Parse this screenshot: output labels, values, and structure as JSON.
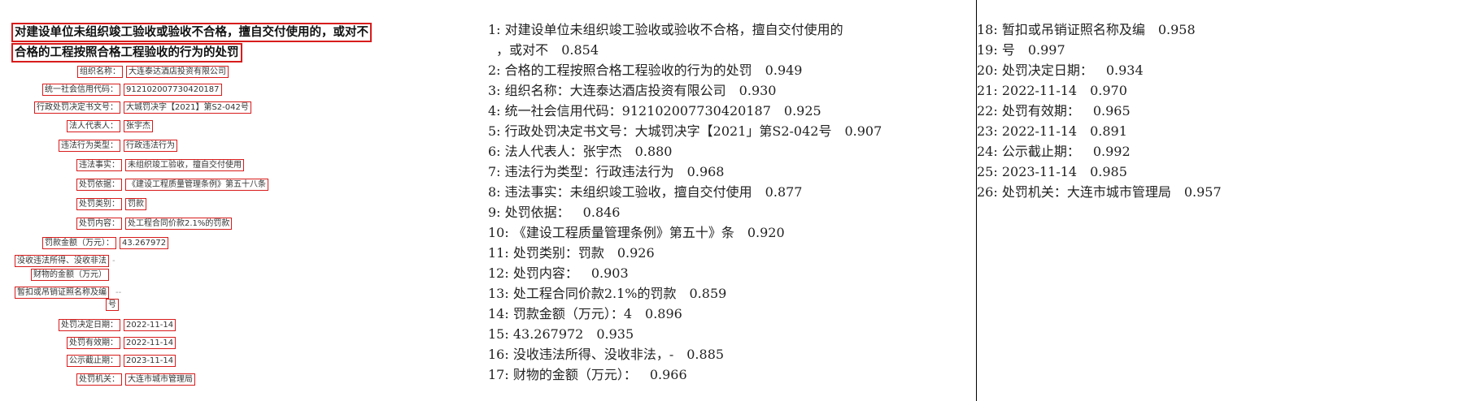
{
  "image_panel": {
    "title_lines": [
      "对建设单位未组织竣工验收或验收不合格，擅自交付使用的，或对不",
      "合格的工程按照合格工程验收的行为的处罚"
    ],
    "fields": [
      {
        "label": "组织名称：",
        "value": "大连泰达酒店投资有限公司"
      },
      {
        "label": "统一社会信用代码：",
        "value": "912102007730420187"
      },
      {
        "label": "行政处罚决定书文号：",
        "value": "大城罚决字【2021】第S2-042号"
      },
      {
        "label": "法人代表人：",
        "value": "张宇杰"
      },
      {
        "label": "违法行为类型：",
        "value": "行政违法行为"
      },
      {
        "label": "违法事实：",
        "value": "未组织竣工验收，擅自交付使用"
      },
      {
        "label": "处罚依据：",
        "value": "《建设工程质量管理条例》第五十八条"
      },
      {
        "label": "处罚类别：",
        "value": "罚款"
      },
      {
        "label": "处罚内容：",
        "value": "处工程合同价款2.1%的罚款"
      },
      {
        "label": "罚款金额（万元）：",
        "value": "43.267972"
      },
      {
        "label": "没收违法所得、没收非法",
        "value": "-"
      },
      {
        "label": "财物的金额（万元）",
        "value": ""
      },
      {
        "label": "暂扣或吊销证照名称及编",
        "value": "--"
      },
      {
        "label": "号",
        "value": ""
      },
      {
        "label": "处罚决定日期：",
        "value": "2022-11-14"
      },
      {
        "label": "处罚有效期：",
        "value": "2022-11-14"
      },
      {
        "label": "公示截止期：",
        "value": "2023-11-14"
      },
      {
        "label": "处罚机关：",
        "value": "大连市城市管理局"
      }
    ]
  },
  "ocr_results": [
    {
      "text": "1: 对建设单位未组织竣工验收或验收不合格，擅自交付使用的",
      "score": ""
    },
    {
      "text": "  ，或对不",
      "score": "0.854"
    },
    {
      "text": "2: 合格的工程按照合格工程验收的行为的处罚",
      "score": "0.949"
    },
    {
      "text": "3: 组织名称：大连泰达酒店投资有限公司",
      "score": "0.930"
    },
    {
      "text": "4: 统一社会信用代码：912102007730420187",
      "score": "0.925"
    },
    {
      "text": "5: 行政处罚决定书文号：大城罚决字【2021」第S2-042号",
      "score": "0.907"
    },
    {
      "text": "6: 法人代表人：张宇杰",
      "score": "0.880"
    },
    {
      "text": "7: 违法行为类型：行政违法行为",
      "score": "0.968"
    },
    {
      "text": "8: 违法事实：未组织竣工验收，擅自交付使用",
      "score": "0.877"
    },
    {
      "text": "9: 处罚依据：",
      "score": "0.846"
    },
    {
      "text": "10: 《建设工程质量管理条例》第五十》条",
      "score": "0.920"
    },
    {
      "text": "11: 处罚类别：罚款",
      "score": "0.926"
    },
    {
      "text": "12: 处罚内容：",
      "score": "0.903"
    },
    {
      "text": "13: 处工程合同价款2.1%的罚款",
      "score": "0.859"
    },
    {
      "text": "14: 罚款金额（万元）：4",
      "score": "0.896"
    },
    {
      "text": "15: 43.267972",
      "score": "0.935"
    },
    {
      "text": "16: 没收违法所得、没收非法，-",
      "score": "0.885"
    },
    {
      "text": "17: 财物的金额（万元）：",
      "score": "0.966"
    },
    {
      "text": "18: 暂扣或吊销证照名称及编",
      "score": "0.958"
    },
    {
      "text": "19: 号",
      "score": "0.997"
    },
    {
      "text": "20: 处罚决定日期：",
      "score": "0.934"
    },
    {
      "text": "21: 2022-11-14",
      "score": "0.970"
    },
    {
      "text": "22: 处罚有效期：",
      "score": "0.965"
    },
    {
      "text": "23: 2022-11-14",
      "score": "0.891"
    },
    {
      "text": "24: 公示截止期：",
      "score": "0.992"
    },
    {
      "text": "25: 2023-11-14",
      "score": "0.985"
    },
    {
      "text": "26: 处罚机关：大连市城市管理局",
      "score": "0.957"
    }
  ]
}
